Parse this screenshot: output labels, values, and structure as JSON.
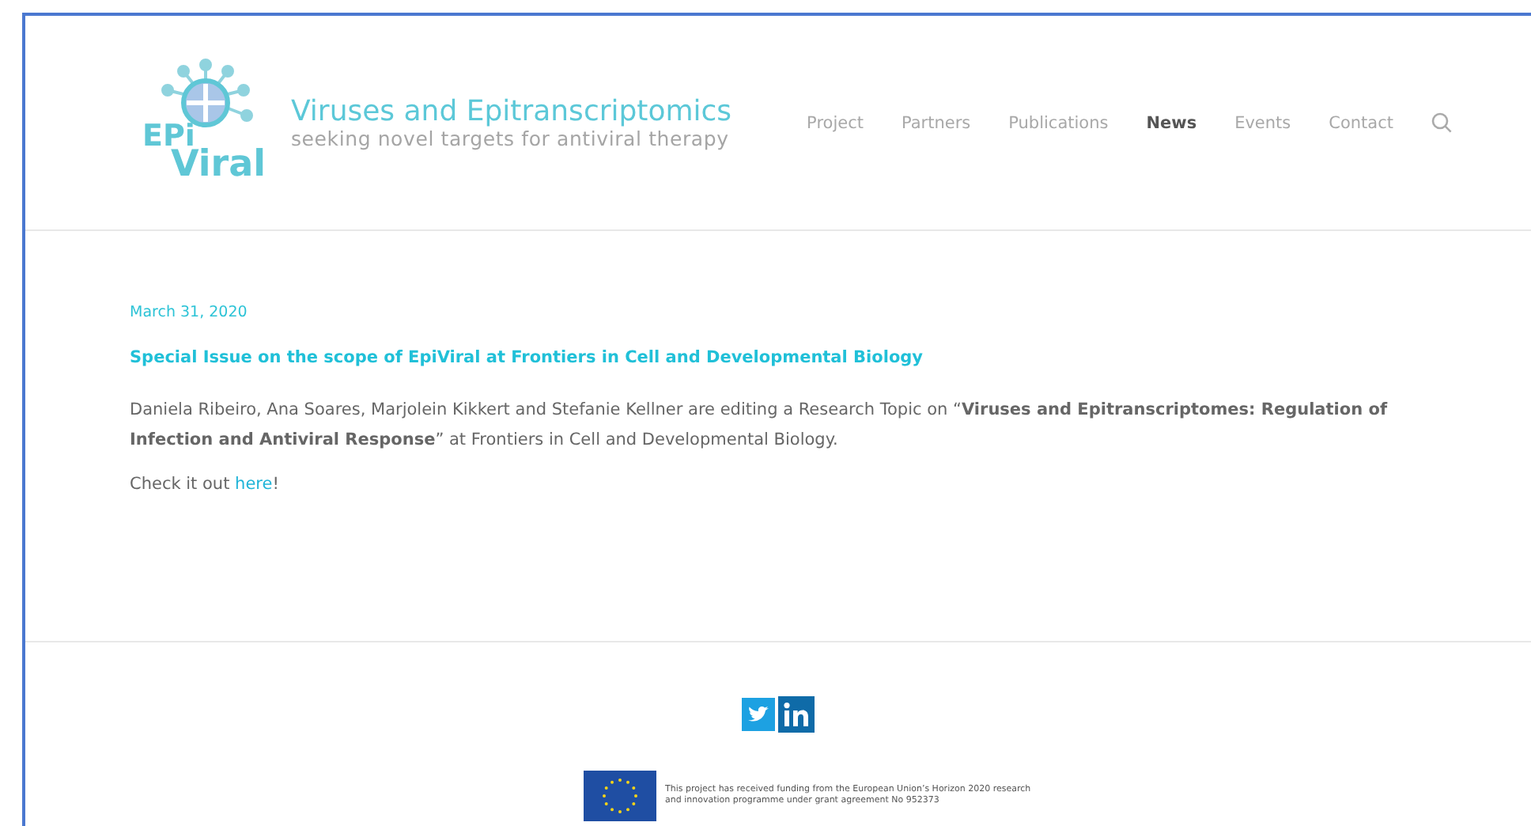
{
  "logo": {
    "mark_top": "EPi",
    "mark_bottom": "Viral",
    "title": "Viruses and Epitranscriptomics",
    "tagline": "seeking novel targets for antiviral therapy"
  },
  "nav": [
    {
      "label": "Project",
      "selected": false
    },
    {
      "label": "Partners",
      "selected": false
    },
    {
      "label": "Publications",
      "selected": false
    },
    {
      "label": "News",
      "selected": true
    },
    {
      "label": "Events",
      "selected": false
    },
    {
      "label": "Contact",
      "selected": false
    }
  ],
  "post": {
    "date": "March 31, 2020",
    "title": "Special Issue on the scope of EpiViral at Frontiers in Cell and Developmental Biology",
    "body": "Daniela Ribeiro, Ana Soares, Marjolein Kikkert and Stefanie Kellner are editing a Research Topic on “**Viruses and Epitranscriptomes: Regulation of Infection and Antiviral Response**” at Frontiers in Cell and Developmental Biology.",
    "cta_before": "Check it out ",
    "cta_link": "here",
    "cta_after": "!"
  },
  "footer": {
    "funding": "This project has received funding from the European Union’s Horizon 2020 research and innovation programme under grant agreement No 952373"
  }
}
